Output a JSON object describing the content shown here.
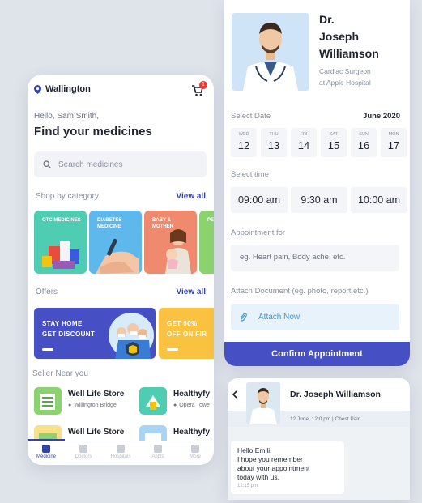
{
  "left_app": {
    "location": "Wallington",
    "cart_count": "1",
    "greeting": "Hello, Sam Smith,",
    "headline": "Find your medicines",
    "search_placeholder": "Search medicines",
    "category_section": {
      "title": "Shop by category",
      "view_all": "View all"
    },
    "categories": [
      {
        "label": "OTC MEDICINES",
        "color": "#4ecdb3"
      },
      {
        "label": "DIABETES MEDICINE",
        "color": "#5fb8ec"
      },
      {
        "label": "BABY & MOTHER",
        "color": "#f08a6e"
      },
      {
        "label": "PE CA",
        "color": "#8ad36e"
      }
    ],
    "offers_section": {
      "title": "Offers",
      "view_all": "View all"
    },
    "offers": [
      {
        "line1": "STAY HOME",
        "line2": "GET DISCOUNT",
        "color": "#4650c4"
      },
      {
        "line1": "GET 50%",
        "line2": "OFF ON FIR",
        "color": "#f9c341"
      }
    ],
    "seller_section": {
      "title": "Seller Near you"
    },
    "sellers": [
      {
        "name": "Well Life Store",
        "location": "Willington Bridge"
      },
      {
        "name": "Healthyfy",
        "location": "Opera Towe"
      },
      {
        "name": "Well Life Store",
        "location": ""
      },
      {
        "name": "Healthyfy",
        "location": ""
      }
    ],
    "nav": [
      {
        "label": "Medicine",
        "icon": "pill-icon"
      },
      {
        "label": "Doctors",
        "icon": "doctor-icon"
      },
      {
        "label": "Hospitals",
        "icon": "location-icon"
      },
      {
        "label": "Appts",
        "icon": "calendar-icon"
      },
      {
        "label": "More",
        "icon": "user-icon"
      }
    ]
  },
  "appointment": {
    "doctor_title": "Dr.",
    "doctor_first": "Joseph",
    "doctor_last": "Williamson",
    "role": "Cardiac Surgeon",
    "hospital": "at Apple Hospital",
    "select_date_label": "Select Date",
    "month": "June 2020",
    "dates": [
      {
        "dow": "WED",
        "num": "12"
      },
      {
        "dow": "THU",
        "num": "13"
      },
      {
        "dow": "FRI",
        "num": "14"
      },
      {
        "dow": "SAT",
        "num": "15"
      },
      {
        "dow": "SUN",
        "num": "16"
      },
      {
        "dow": "MON",
        "num": "17"
      }
    ],
    "select_time_label": "Select time",
    "times": [
      "09:00 am",
      "9:30 am",
      "10:00 am"
    ],
    "appointment_for_label": "Appointment for",
    "appointment_for_placeholder": "eg. Heart pain, Body ache, etc.",
    "attach_label": "Attach Document (eg. photo, report.etc.)",
    "attach_button": "Attach Now",
    "confirm_button": "Confirm Appointment"
  },
  "chat": {
    "doctor_name": "Dr. Joseph Williamson",
    "meta": "12 June, 12:0 pm  |  Chest Pain",
    "message": "Hello Emili,\nI hope you remember\nabout your appointment\ntoday with us.",
    "time": "12:15 pm"
  }
}
